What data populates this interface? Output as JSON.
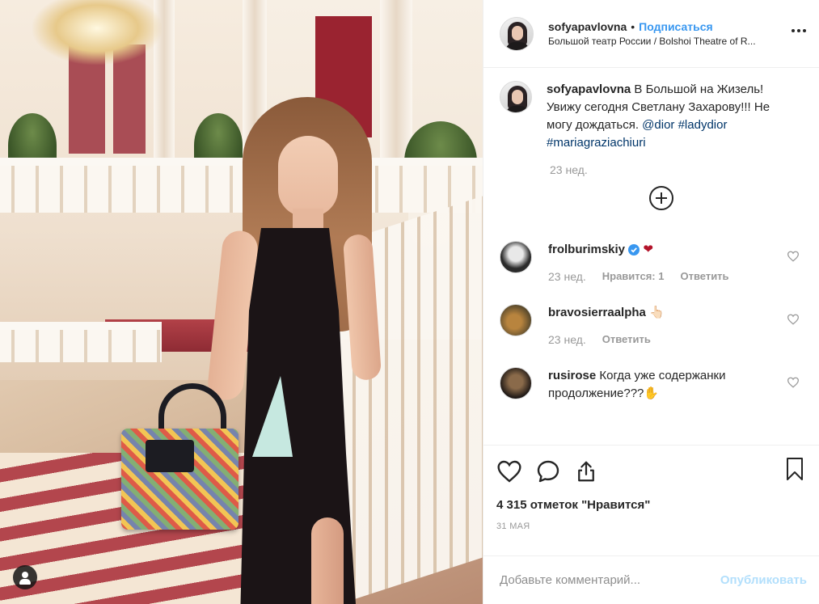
{
  "post": {
    "username": "sofyapavlovna",
    "separator": "•",
    "follow_label": "Подписаться",
    "location": "Большой театр России / Bolshoi Theatre of R...",
    "caption_text": "В Большой на Жизель! Увижу сегодня Светлану Захарову!!! Не могу дождаться.",
    "caption_tags": [
      "@dior",
      "#ladydior",
      "#mariagraziachiuri"
    ],
    "caption_time": "23 нед.",
    "likes": "4 315 отметок \"Нравится\"",
    "date": "31 мая"
  },
  "comments": [
    {
      "username": "frolburimskiy",
      "verified": true,
      "text": "❤",
      "time": "23 нед.",
      "likes_label": "Нравится: 1",
      "reply_label": "Ответить"
    },
    {
      "username": "bravosierraalpha",
      "verified": false,
      "text": "👆🏻",
      "time": "23 нед.",
      "likes_label": "",
      "reply_label": "Ответить"
    },
    {
      "username": "rusirose",
      "verified": false,
      "text": "Когда уже содержанки продолжение???✋",
      "time": "",
      "likes_label": "",
      "reply_label": ""
    }
  ],
  "add_comment": {
    "placeholder": "Добавьте комментарий...",
    "post_label": "Опубликовать"
  },
  "colors": {
    "accent": "#3897f0",
    "link": "#003569",
    "muted": "#999999",
    "post_disabled": "#b2dffc",
    "heart": "#ed4956"
  },
  "icons": [
    "heart-icon",
    "comment-icon",
    "share-icon",
    "bookmark-icon",
    "more-icon",
    "load-more-icon",
    "user-tag-icon",
    "verified-icon"
  ]
}
